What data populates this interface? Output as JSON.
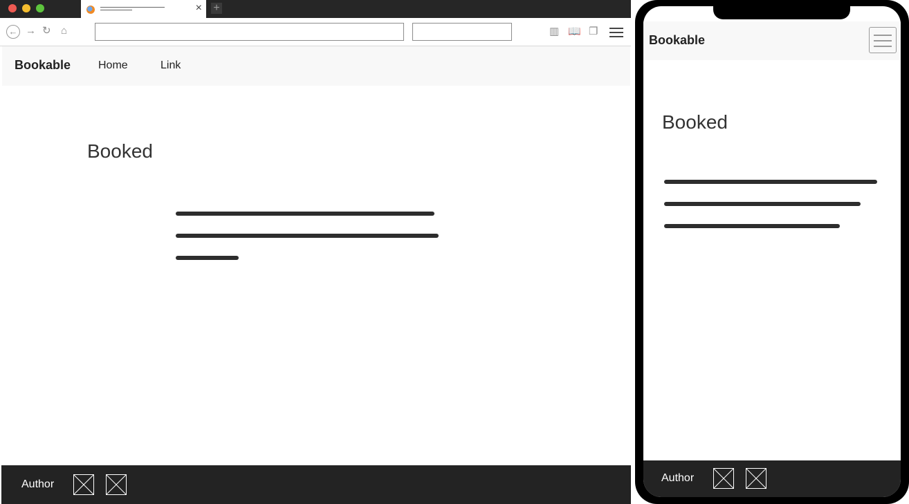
{
  "browser": {
    "site": {
      "brand": "Bookable",
      "nav_links": [
        "Home",
        "Link"
      ],
      "heading": "Booked",
      "footer_author": "Author"
    }
  },
  "mobile": {
    "brand": "Bookable",
    "heading": "Booked",
    "footer_author": "Author"
  },
  "icons": {
    "tab_close": "×",
    "new_tab": "+",
    "back": "←",
    "forward": "→",
    "reload": "↻",
    "home": "⌂",
    "library": "▥",
    "reader": "📖",
    "sidebar": "❐"
  },
  "colors": {
    "chrome_dark": "#262626",
    "navbar_bg": "#f8f8f8",
    "footer_bg": "#232323",
    "text_line": "#2d2d2d",
    "traffic_red": "#ee5a52",
    "traffic_yellow": "#f5bd2f",
    "traffic_green": "#5dc43d"
  }
}
